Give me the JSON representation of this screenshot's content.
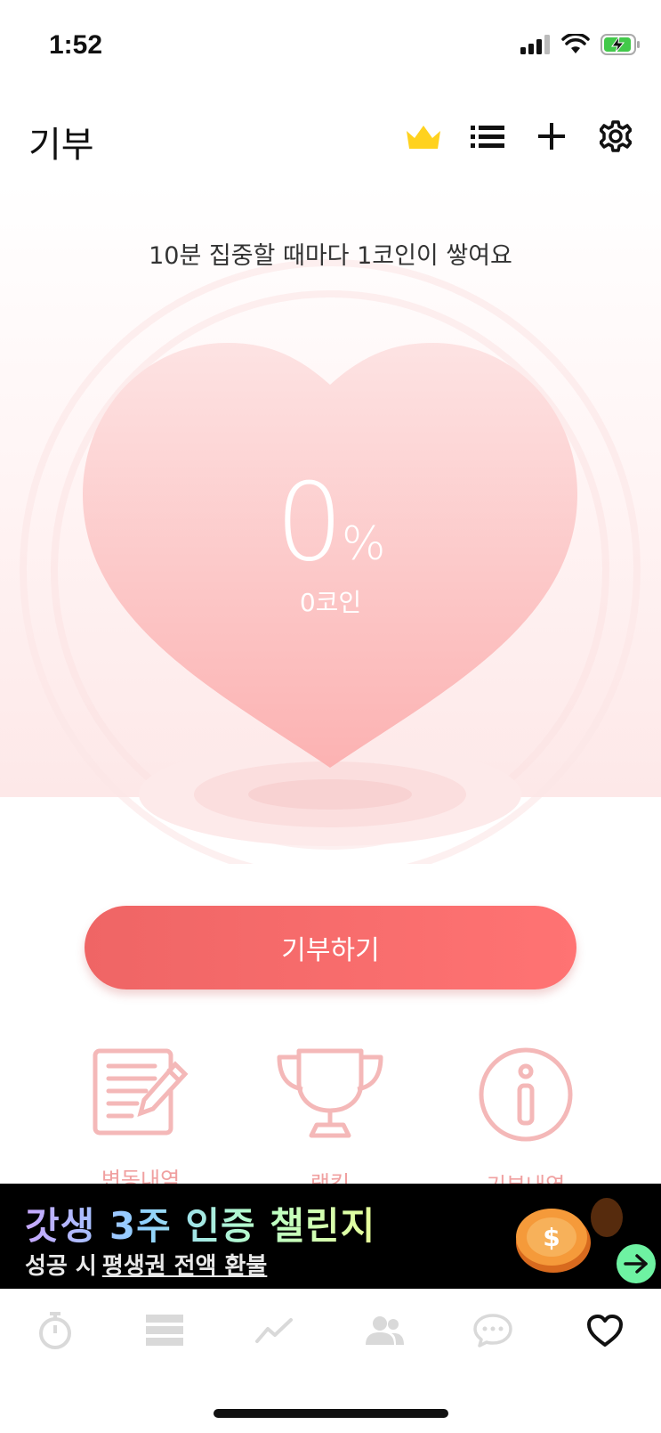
{
  "status": {
    "time": "1:52"
  },
  "header": {
    "title": "기부"
  },
  "hero": {
    "caption": "10분 집중할 때마다 1코인이 쌓여요",
    "percent_value": "0",
    "percent_sign": "%",
    "coins_label": "0코인"
  },
  "donate_button": {
    "label": "기부하기"
  },
  "menu": [
    {
      "label": "변동내역",
      "icon": "document-edit-icon"
    },
    {
      "label": "랭킹",
      "icon": "trophy-icon"
    },
    {
      "label": "기부내역",
      "icon": "info-icon"
    }
  ],
  "ad": {
    "headline": "갓생 3주 인증 챌린지",
    "sub_prefix": "성공 시",
    "sub_link": "평생권 전액 환불"
  },
  "tabs": [
    {
      "icon": "stopwatch-icon"
    },
    {
      "icon": "list-stack-icon"
    },
    {
      "icon": "chart-line-icon"
    },
    {
      "icon": "people-icon"
    },
    {
      "icon": "chat-bubble-icon"
    },
    {
      "icon": "heart-icon",
      "active": true
    }
  ],
  "colors": {
    "accent": "#ef6565",
    "heart_light": "#fde3e3",
    "heart_dark": "#fcb3b3",
    "crown": "#ffd21f",
    "menu_icon": "#f4b8b8",
    "tab_inactive": "#d9d9d9",
    "tab_active": "#111111"
  }
}
